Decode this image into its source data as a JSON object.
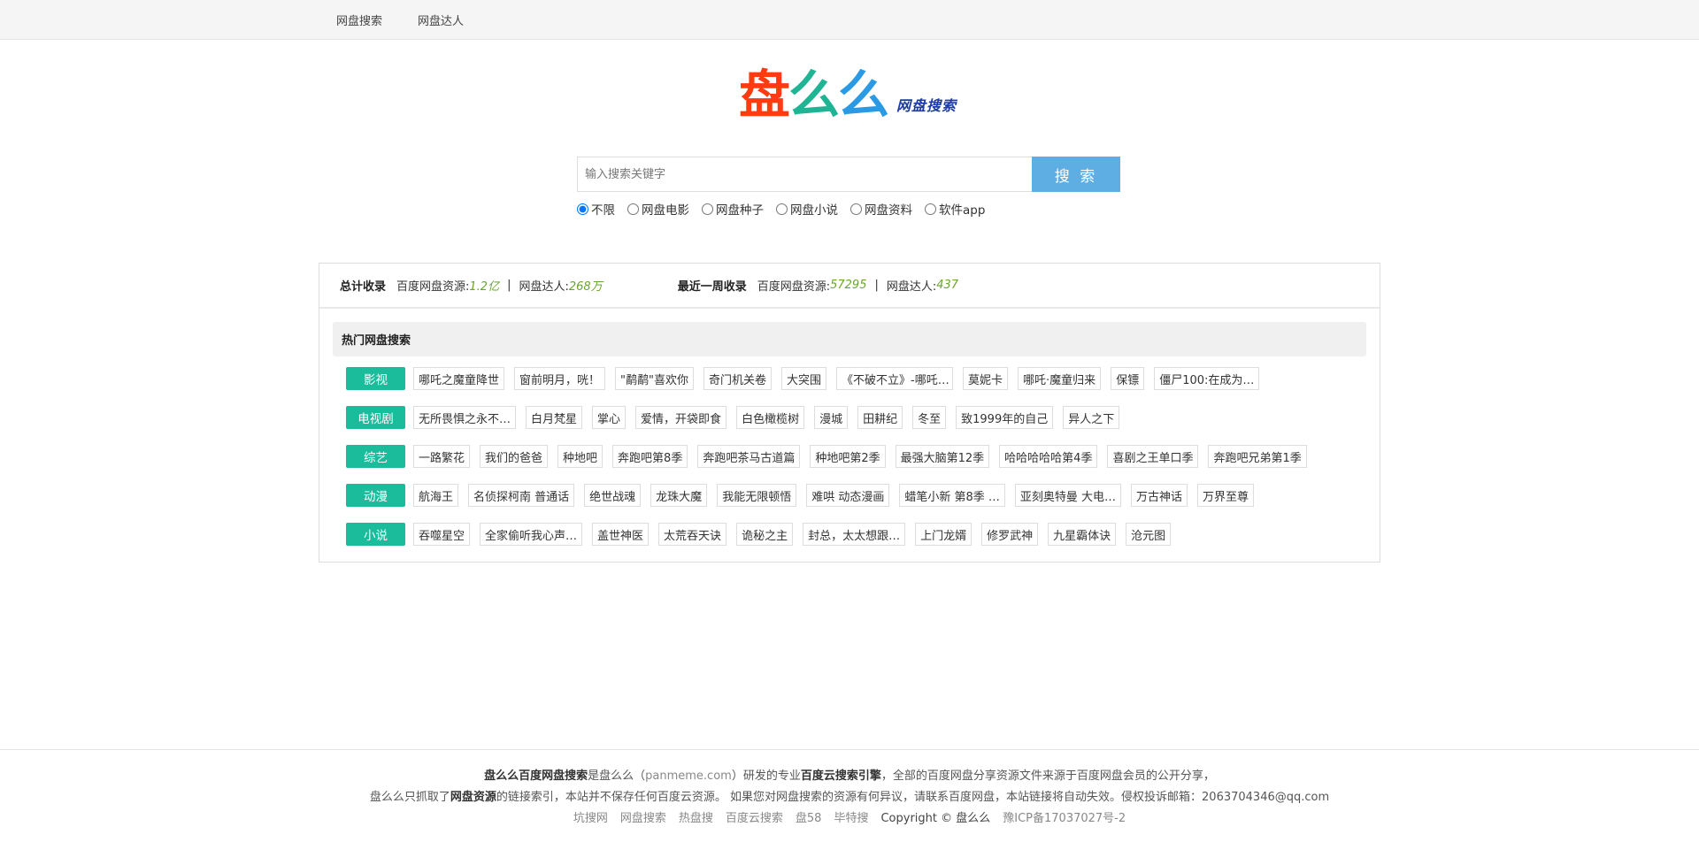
{
  "nav": {
    "items": [
      "网盘搜索",
      "网盘达人"
    ]
  },
  "logo": {
    "chars": [
      {
        "text": "盘",
        "color": "#ff3b0f"
      },
      {
        "text": "么",
        "color": "#1fb594"
      },
      {
        "text": "么",
        "color": "#2a9ae5"
      }
    ],
    "subtitle": "网盘搜索"
  },
  "search": {
    "placeholder": "输入搜索关键字",
    "button_label": "搜 索",
    "options": [
      "不限",
      "网盘电影",
      "网盘种子",
      "网盘小说",
      "网盘资料",
      "软件app"
    ],
    "selected": "不限"
  },
  "stats": {
    "total": {
      "label": "总计收录",
      "res_label": "百度网盘资源:",
      "res_value": "1.2亿",
      "sep": "|",
      "user_label": "网盘达人:",
      "user_value": "268万"
    },
    "week": {
      "label": "最近一周收录",
      "res_label": "百度网盘资源:",
      "res_value": "57295",
      "sep": "|",
      "user_label": "网盘达人:",
      "user_value": "437"
    }
  },
  "hot": {
    "title": "热门网盘搜索",
    "rows": [
      {
        "category": "影视",
        "tags": [
          "哪吒之魔童降世",
          "窗前明月，咣！",
          "\"鹬鹬\"喜欢你",
          "奇门机关卷",
          "大突围",
          "《不破不立》-哪吒…",
          "莫妮卡",
          "哪吒·魔童归来",
          "保镖",
          "僵尸100:在成为…"
        ]
      },
      {
        "category": "电视剧",
        "tags": [
          "无所畏惧之永不…",
          "白月梵星",
          "掌心",
          "爱情，开袋即食",
          "白色橄榄树",
          "漫城",
          "田耕纪",
          "冬至",
          "致1999年的自己",
          "异人之下"
        ]
      },
      {
        "category": "综艺",
        "tags": [
          "一路繁花",
          "我们的爸爸",
          "种地吧",
          "奔跑吧第8季",
          "奔跑吧茶马古道篇",
          "种地吧第2季",
          "最强大脑第12季",
          "哈哈哈哈哈第4季",
          "喜剧之王单口季",
          "奔跑吧兄弟第1季"
        ]
      },
      {
        "category": "动漫",
        "tags": [
          "航海王",
          "名侦探柯南 普通话",
          "绝世战魂",
          "龙珠大魔",
          "我能无限顿悟",
          "难哄 动态漫画",
          "蜡笔小新 第8季 …",
          "亚刻奥特曼 大电…",
          "万古神话",
          "万界至尊"
        ]
      },
      {
        "category": "小说",
        "tags": [
          "吞噬星空",
          "全家偷听我心声…",
          "盖世神医",
          "太荒吞天诀",
          "诡秘之主",
          "封总，太太想跟…",
          "上门龙婿",
          "修罗武神",
          "九星霸体诀",
          "沧元图"
        ]
      }
    ]
  },
  "footer": {
    "line1_a": "盘么么百度网盘搜索",
    "line1_b": "是盘么么（",
    "line1_c": "panmeme.com",
    "line1_d": "）研发的专业",
    "line1_e": "百度云搜索引擎",
    "line1_f": "，全部的百度网盘分享资源文件来源于百度网盘会员的公开分享，",
    "line2_a": "盘么么只抓取了",
    "line2_b": "网盘资源",
    "line2_c": "的链接索引，本站并不保存任何百度云资源。 如果您对网盘搜索的资源有何异议，请联系百度网盘，本站链接将自动失效。侵权投诉邮箱：2063704346@qq.com",
    "links": [
      "坑搜网",
      "网盘搜索",
      "热盘搜",
      "百度云搜索",
      "盘58",
      "毕特搜"
    ],
    "copyright": "Copyright © 盘么么",
    "icp": "豫ICP备17037027号-2"
  }
}
